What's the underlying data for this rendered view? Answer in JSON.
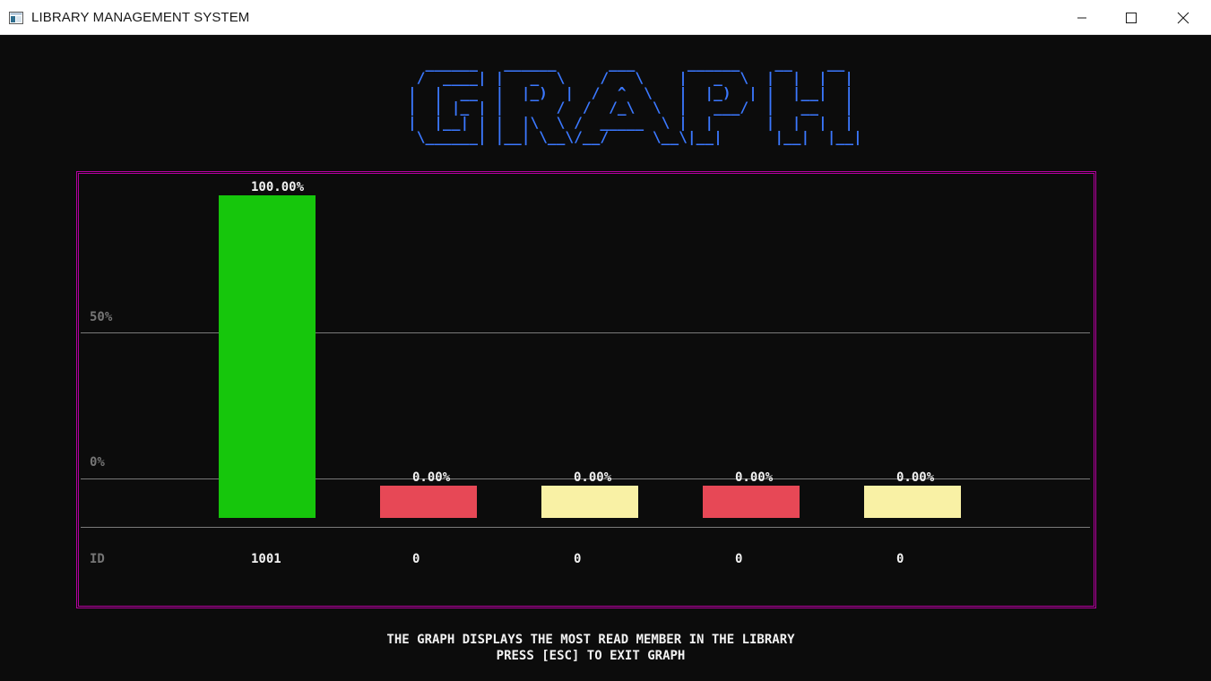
{
  "window": {
    "title": "LIBRARY MANAGEMENT SYSTEM",
    "app_icon": "console-window-icon",
    "controls": {
      "minimize_icon": "minimize-icon",
      "maximize_icon": "maximize-icon",
      "close_icon": "close-icon"
    }
  },
  "banner": {
    "text": "  ______   ______      ___      ______    __    __  \n /  ____| |   _  \\    /   \\    |   _  \\  |  |  |  | \n|  |  __  |  |_)  |  /  ^  \\   |  |_)  | |  |__|  | \n|  | |_ | |      /  /  /_\\  \\  |   ___/  |   __   | \n|  |__| | |  |\\  \\ /  _____  \\ |  |      |  |  |  | \n \\______| |__| \\__\\/__/     \\__\\|__|      |__|  |__| ",
    "color": "#3b78ff"
  },
  "graph": {
    "frame_color": "#b4009e",
    "axis": {
      "label_50": "50%",
      "label_0": "0%",
      "label_id": "ID"
    }
  },
  "chart_data": {
    "type": "bar",
    "categories": [
      "1001",
      "0",
      "0",
      "0",
      "0"
    ],
    "values": [
      100.0,
      0.0,
      0.0,
      0.0,
      0.0
    ],
    "value_labels": [
      "100.00%",
      "0.00%",
      "0.00%",
      "0.00%",
      "0.00%"
    ],
    "colors": [
      "#16c60c",
      "#e74856",
      "#f9f1a5",
      "#e74856",
      "#f9f1a5"
    ],
    "xlabel": "ID",
    "ylabel": "",
    "ylim": [
      0,
      100
    ],
    "yticks": [
      "0%",
      "50%"
    ]
  },
  "footer": {
    "line1": "THE GRAPH DISPLAYS THE MOST READ MEMBER IN THE LIBRARY",
    "line2": "PRESS [ESC] TO EXIT GRAPH"
  }
}
